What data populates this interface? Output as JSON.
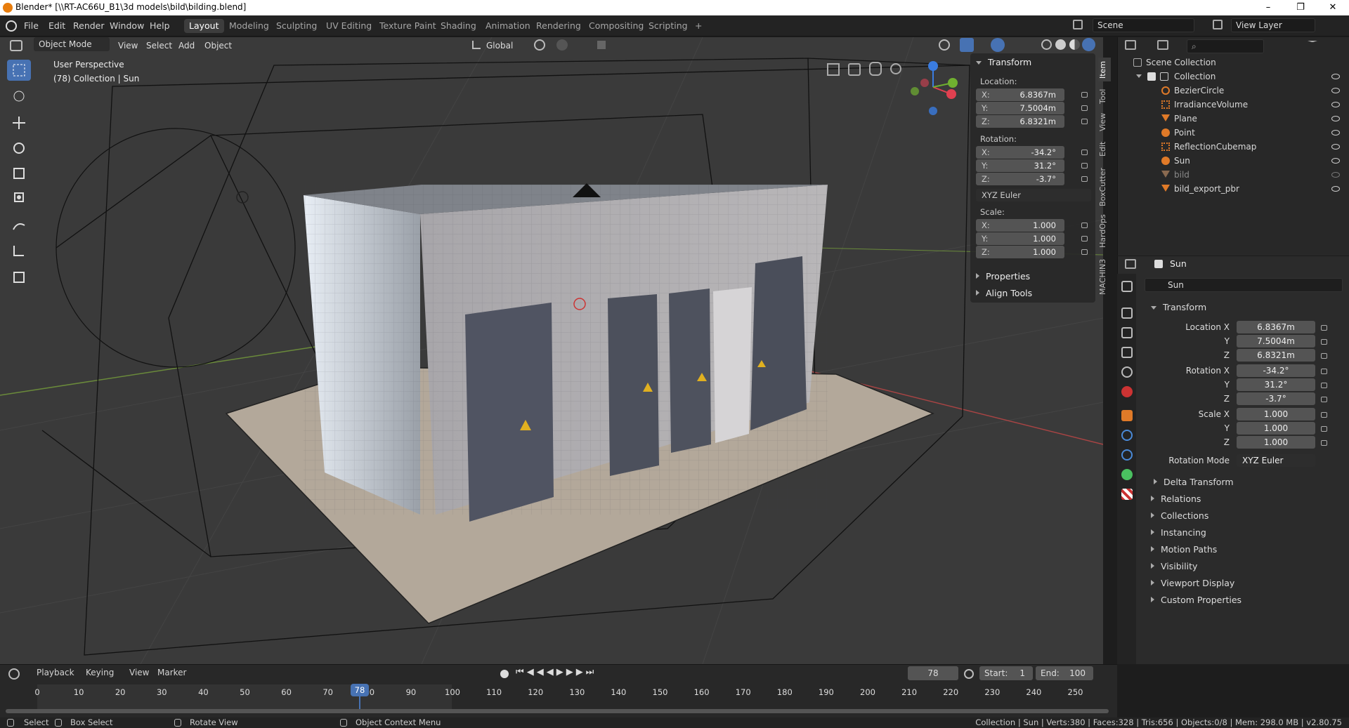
{
  "window": {
    "title": "Blender* [\\\\RT-AC66U_B1\\3d models\\bild\\bilding.blend]"
  },
  "menus": [
    "File",
    "Edit",
    "Render",
    "Window",
    "Help"
  ],
  "workspaces": [
    "Layout",
    "Modeling",
    "Sculpting",
    "UV Editing",
    "Texture Paint",
    "Shading",
    "Animation",
    "Rendering",
    "Compositing",
    "Scripting",
    "+"
  ],
  "scene": "Scene",
  "view_layer": "View Layer",
  "viewport": {
    "mode": "Object Mode",
    "menus": [
      "View",
      "Select",
      "Add",
      "Object"
    ],
    "orientation": "Global",
    "overlay_title": "User Perspective",
    "overlay_sub": "(78) Collection | Sun"
  },
  "npanel": {
    "header": "Transform",
    "location_label": "Location:",
    "location": [
      {
        "axis": "X:",
        "value": "6.8367m"
      },
      {
        "axis": "Y:",
        "value": "7.5004m"
      },
      {
        "axis": "Z:",
        "value": "6.8321m"
      }
    ],
    "rotation_label": "Rotation:",
    "rotation": [
      {
        "axis": "X:",
        "value": "-34.2°"
      },
      {
        "axis": "Y:",
        "value": "31.2°"
      },
      {
        "axis": "Z:",
        "value": "-3.7°"
      }
    ],
    "rotation_mode": "XYZ Euler",
    "scale_label": "Scale:",
    "scale": [
      {
        "axis": "X:",
        "value": "1.000"
      },
      {
        "axis": "Y:",
        "value": "1.000"
      },
      {
        "axis": "Z:",
        "value": "1.000"
      }
    ],
    "sections": [
      "Properties",
      "Align Tools"
    ],
    "tabs": [
      "Item",
      "Tool",
      "View",
      "Edit",
      "BoxCutter",
      "HardOps",
      "MACHIN3"
    ]
  },
  "outliner": {
    "root": "Scene Collection",
    "collection": "Collection",
    "items": [
      {
        "name": "BezierCircle",
        "icon": "curve-icon",
        "color": "#e07a28"
      },
      {
        "name": "IrradianceVolume",
        "icon": "lightprobe-icon",
        "color": "#e07a28"
      },
      {
        "name": "Plane",
        "icon": "mesh-icon",
        "color": "#e07a28"
      },
      {
        "name": "Point",
        "icon": "light-icon",
        "color": "#e07a28"
      },
      {
        "name": "ReflectionCubemap",
        "icon": "lightprobe-icon",
        "color": "#e07a28"
      },
      {
        "name": "Sun",
        "icon": "light-icon",
        "color": "#e07a28"
      },
      {
        "name": "bild",
        "icon": "mesh-icon",
        "color": "#8a6a50"
      },
      {
        "name": "bild_export_pbr",
        "icon": "mesh-icon",
        "color": "#e07a28"
      }
    ]
  },
  "properties": {
    "object_name": "Sun",
    "datablock": "Sun",
    "transform_label": "Transform",
    "location": {
      "labels": [
        "Location X",
        "Y",
        "Z"
      ],
      "values": [
        "6.8367m",
        "7.5004m",
        "6.8321m"
      ]
    },
    "rotation": {
      "labels": [
        "Rotation X",
        "Y",
        "Z"
      ],
      "values": [
        "-34.2°",
        "31.2°",
        "-3.7°"
      ]
    },
    "scale": {
      "labels": [
        "Scale X",
        "Y",
        "Z"
      ],
      "values": [
        "1.000",
        "1.000",
        "1.000"
      ]
    },
    "rotation_mode_label": "Rotation Mode",
    "rotation_mode": "XYZ Euler",
    "delta": "Delta Transform",
    "sections": [
      "Relations",
      "Collections",
      "Instancing",
      "Motion Paths",
      "Visibility",
      "Viewport Display",
      "Custom Properties"
    ]
  },
  "timeline": {
    "menus": [
      "Playback",
      "Keying",
      "View",
      "Marker"
    ],
    "current_frame": "78",
    "start_label": "Start:",
    "start": "1",
    "end_label": "End:",
    "end": "100",
    "ticks": [
      "0",
      "10",
      "20",
      "30",
      "40",
      "50",
      "60",
      "70",
      "80",
      "90",
      "100",
      "110",
      "120",
      "130",
      "140",
      "150",
      "160",
      "170",
      "180",
      "190",
      "200",
      "210",
      "220",
      "230",
      "240",
      "250"
    ],
    "playhead": "78"
  },
  "statusbar": {
    "select": "Select",
    "box_select": "Box Select",
    "rotate": "Rotate View",
    "context": "Object Context Menu",
    "stats": "Collection | Sun | Verts:380 | Faces:328 | Tris:656 | Objects:0/8 | Mem: 298.0 MB | v2.80.75"
  },
  "colors": {
    "accent": "#4772b3",
    "orange": "#e87d0d",
    "active_ws": "#3d3d3d"
  }
}
